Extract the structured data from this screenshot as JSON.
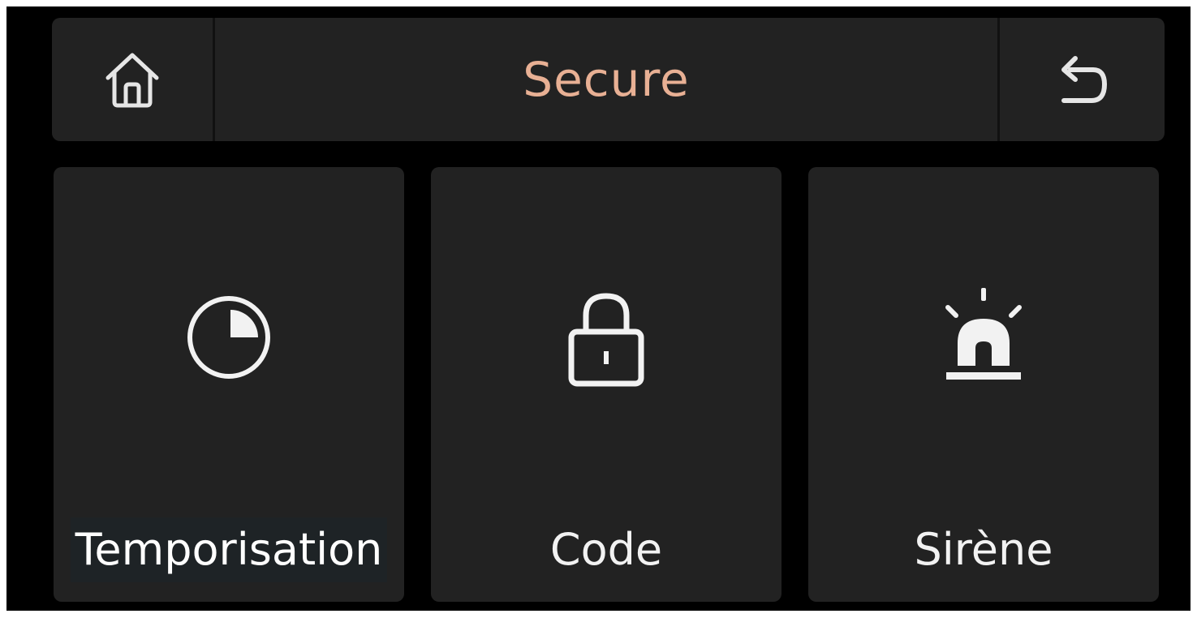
{
  "header": {
    "title": "Secure",
    "home_icon": "home-icon",
    "back_icon": "back-arrow-icon"
  },
  "tiles": [
    {
      "label": "Temporisation",
      "icon": "timer-icon"
    },
    {
      "label": "Code",
      "icon": "lock-icon"
    },
    {
      "label": "Sirène",
      "icon": "siren-icon"
    }
  ],
  "colors": {
    "background": "#000000",
    "panel": "#222222",
    "title": "#e8b094",
    "text": "#f2f2f2"
  }
}
